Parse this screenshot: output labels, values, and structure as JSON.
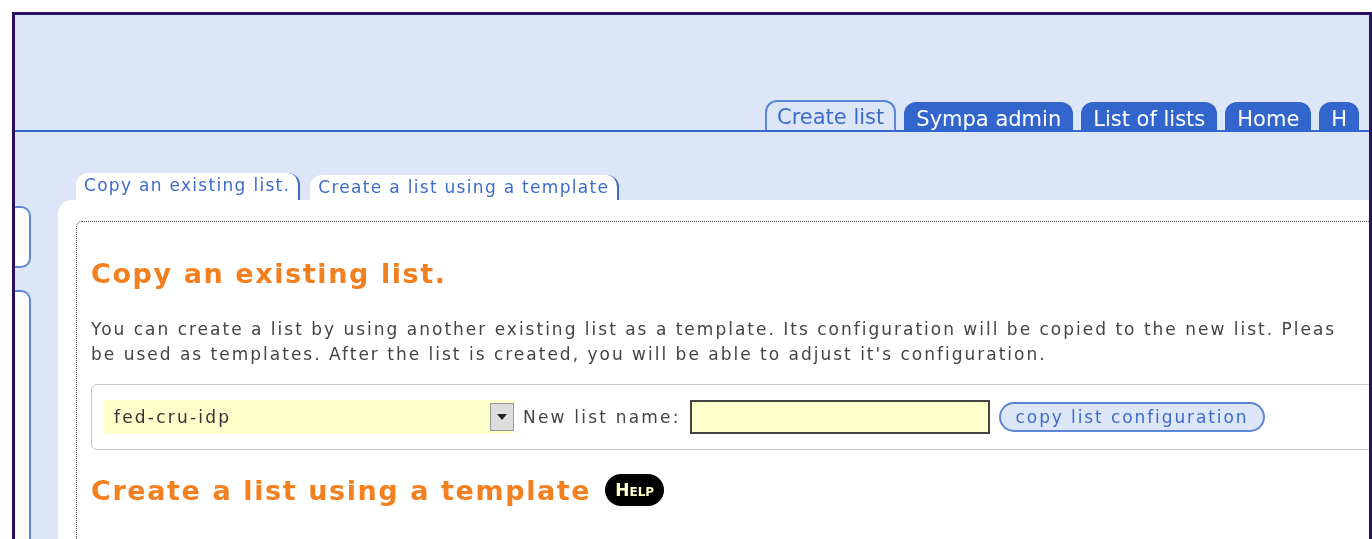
{
  "main_tabs": [
    {
      "label": "Create list",
      "selected": true
    },
    {
      "label": "Sympa admin",
      "selected": false
    },
    {
      "label": "List of lists",
      "selected": false
    },
    {
      "label": "Home",
      "selected": false
    },
    {
      "label": "H",
      "selected": false
    }
  ],
  "sub_tabs": [
    {
      "label": "Copy an existing list.",
      "selected": true
    },
    {
      "label": "Create a list using a template",
      "selected": false
    }
  ],
  "copy_section": {
    "heading": "Copy an existing list.",
    "description_lines": [
      "You can create a list by using another existing list as a template. Its configuration will be copied to the new list. Pleas",
      "be used as templates. After the list is created, you will be able to adjust it's configuration."
    ],
    "source_list": {
      "value": "fed-cru-idp"
    },
    "new_name_label": "New list name:",
    "button": "copy list configuration"
  },
  "template_section": {
    "heading": "Create a list using a template",
    "help": "Help"
  }
}
